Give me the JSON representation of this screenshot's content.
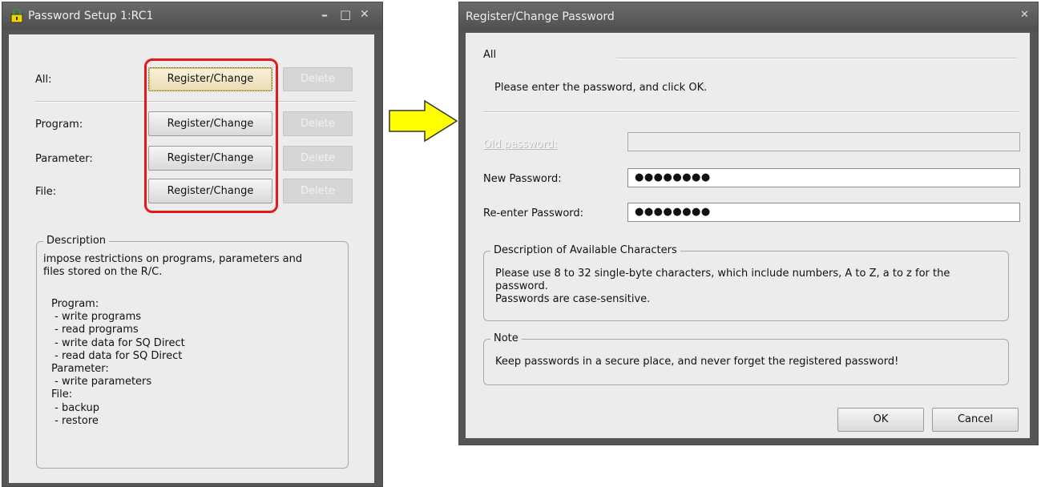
{
  "left_window": {
    "title": "Password Setup 1:RC1",
    "controls": {
      "minimize": "–",
      "maximize": "□",
      "close": "✕"
    },
    "rows": [
      {
        "label": "All:",
        "register_label": "Register/Change",
        "delete_label": "Delete"
      },
      {
        "label": "Program:",
        "register_label": "Register/Change",
        "delete_label": "Delete"
      },
      {
        "label": "Parameter:",
        "register_label": "Register/Change",
        "delete_label": "Delete"
      },
      {
        "label": "File:",
        "register_label": "Register/Change",
        "delete_label": "Delete"
      }
    ],
    "description": {
      "legend": "Description",
      "intro": "impose restrictions on programs, parameters and\nfiles stored on the R/C.",
      "details": "Program:\n - write programs\n - read programs\n - write data for SQ Direct\n - read data for SQ Direct\nParameter:\n - write parameters\nFile:\n - backup\n - restore"
    }
  },
  "right_window": {
    "title": "Register/Change Password",
    "close": "✕",
    "section_label": "All",
    "instruction": "Please enter the password, and click OK.",
    "fields": [
      {
        "label": "Old password:",
        "value": "",
        "enabled": false
      },
      {
        "label": "New Password:",
        "value": "●●●●●●●●",
        "enabled": true
      },
      {
        "label": "Re-enter Password:",
        "value": "●●●●●●●●",
        "enabled": true
      }
    ],
    "chars_group": {
      "legend": "Description of Available Characters",
      "text": "Please use 8 to 32 single-byte characters, which include numbers, A to Z, a to z for the\npassword.\nPasswords are case-sensitive."
    },
    "note_group": {
      "legend": "Note",
      "text": "Keep passwords in a secure place, and never forget the registered password!"
    },
    "ok_label": "OK",
    "cancel_label": "Cancel"
  },
  "colors": {
    "highlight": "#e31a1a",
    "arrow_fill": "#ffff00",
    "titlebar": "#5a5a5a"
  }
}
